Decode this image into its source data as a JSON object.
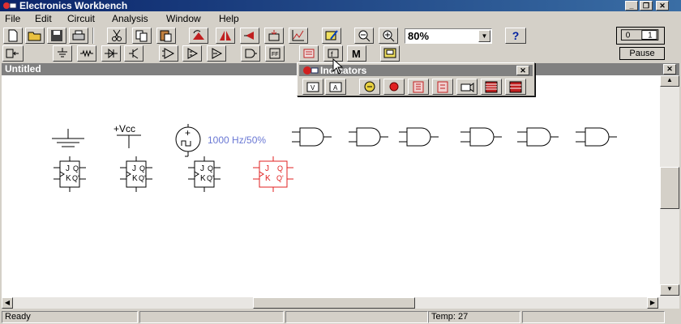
{
  "window": {
    "title": "Electronics Workbench",
    "minimize": "_",
    "maximize": "❐",
    "close": "✕"
  },
  "menu": [
    "File",
    "Edit",
    "Circuit",
    "Analysis",
    "Window",
    "Help"
  ],
  "toolbar": {
    "zoom_value": "80%",
    "help_label": "?",
    "pause_label": "Pause"
  },
  "circuit_window": {
    "title": "Untitled",
    "close": "✕"
  },
  "canvas": {
    "vcc_label": "+Vcc",
    "clock_label": "1000 Hz/50%",
    "clock_plus": "+",
    "flipflop": {
      "j": "J",
      "k": "K",
      "q": "Q",
      "qbar": "Q'"
    }
  },
  "indicators": {
    "title": "Indicators",
    "close": "✕"
  },
  "status": {
    "ready": "Ready",
    "temp": "Temp: 27"
  },
  "colors": {
    "selected_part": "#e02020",
    "clock_text": "#6a78d4",
    "titlebar": "#0a246a"
  }
}
